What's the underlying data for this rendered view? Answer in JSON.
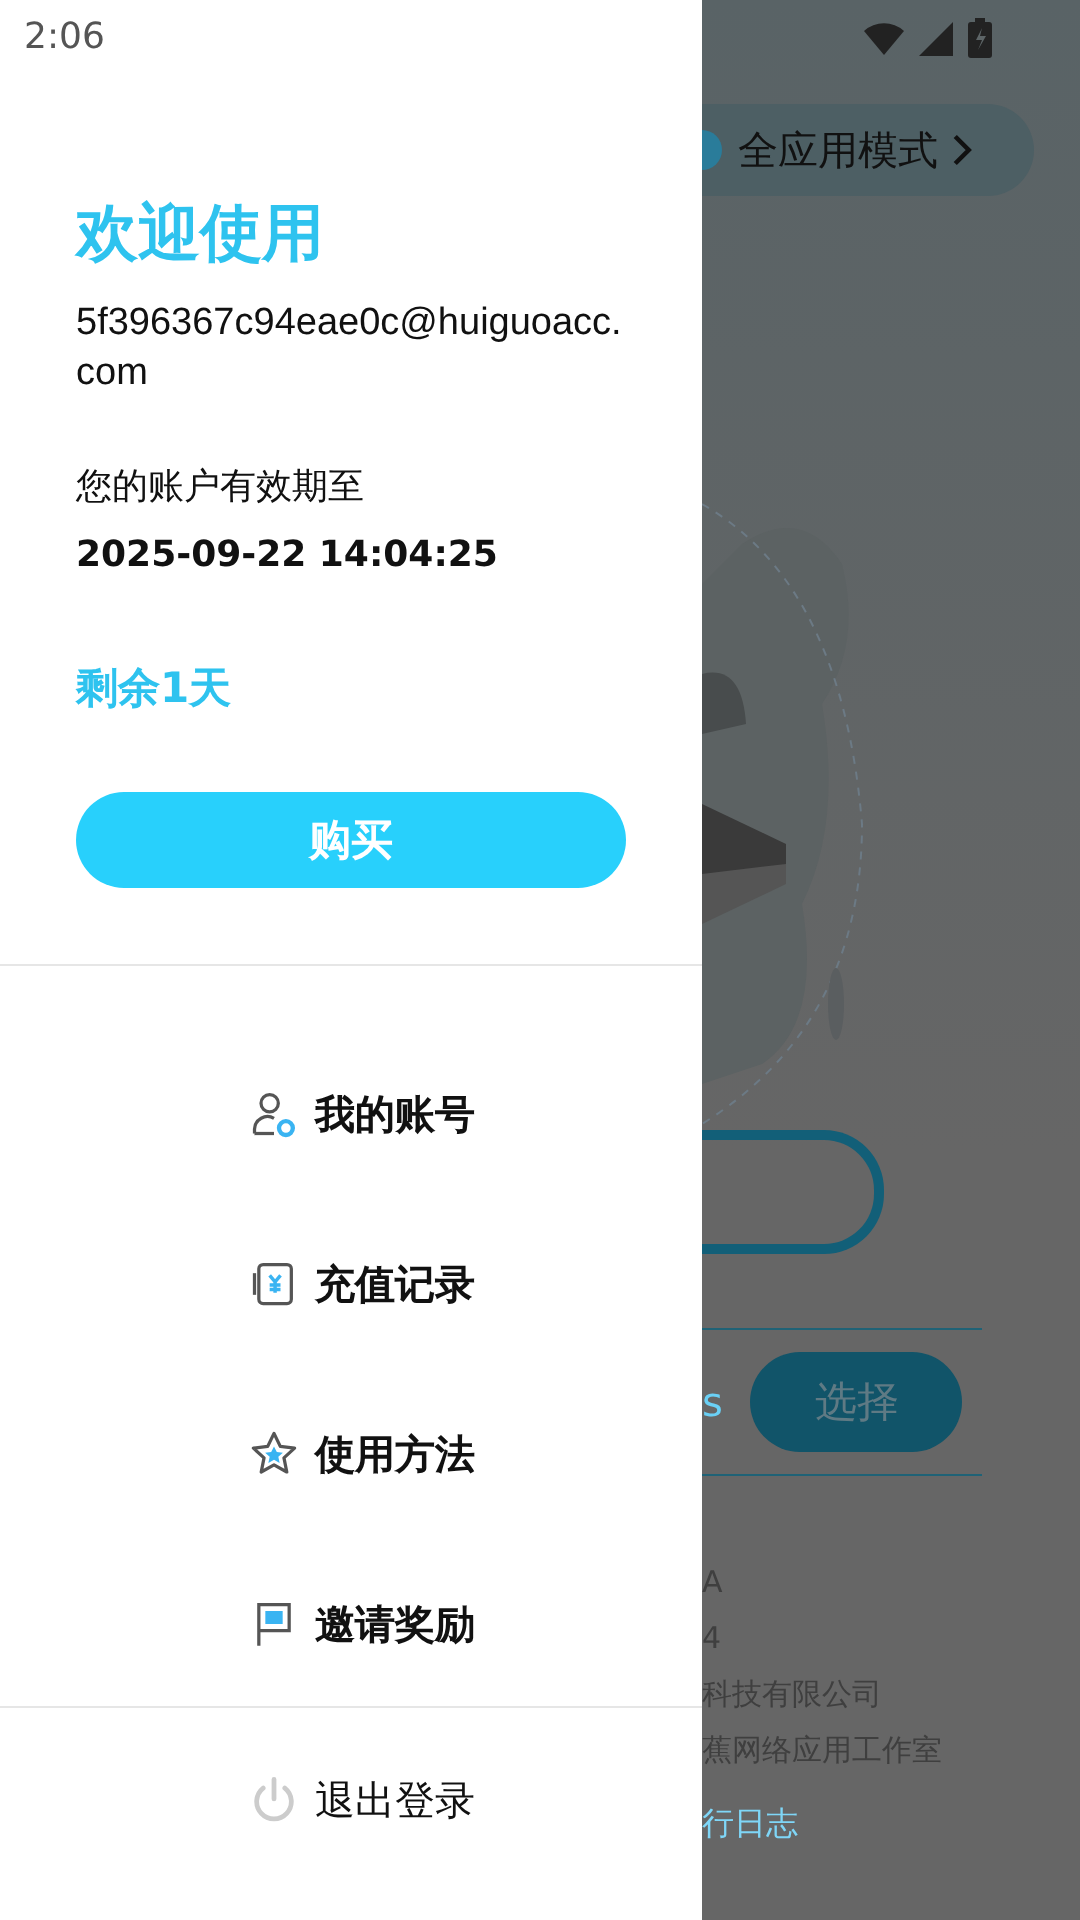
{
  "status_bar": {
    "time": "2:06"
  },
  "drawer": {
    "title": "欢迎使用",
    "email": "5f396367c94eae0c@huiguoacc.com",
    "validity_label": "您的账户有效期至",
    "expiry": "2025-09-22 14:04:25",
    "remaining": "剩余1天",
    "buy_button": "购买",
    "menu": [
      {
        "label": "我的账号"
      },
      {
        "label": "充值记录"
      },
      {
        "label": "使用方法"
      },
      {
        "label": "邀请奖励"
      }
    ],
    "logout": "退出登录"
  },
  "background": {
    "mode_button": "全应用模式",
    "partial_text": "s",
    "select_button": "选择",
    "info_lines": [
      {
        "text": "A"
      },
      {
        "text": "4"
      },
      {
        "text": "科技有限公司"
      },
      {
        "text": "蕉网络应用工作室"
      }
    ],
    "log_link": "行日志"
  }
}
